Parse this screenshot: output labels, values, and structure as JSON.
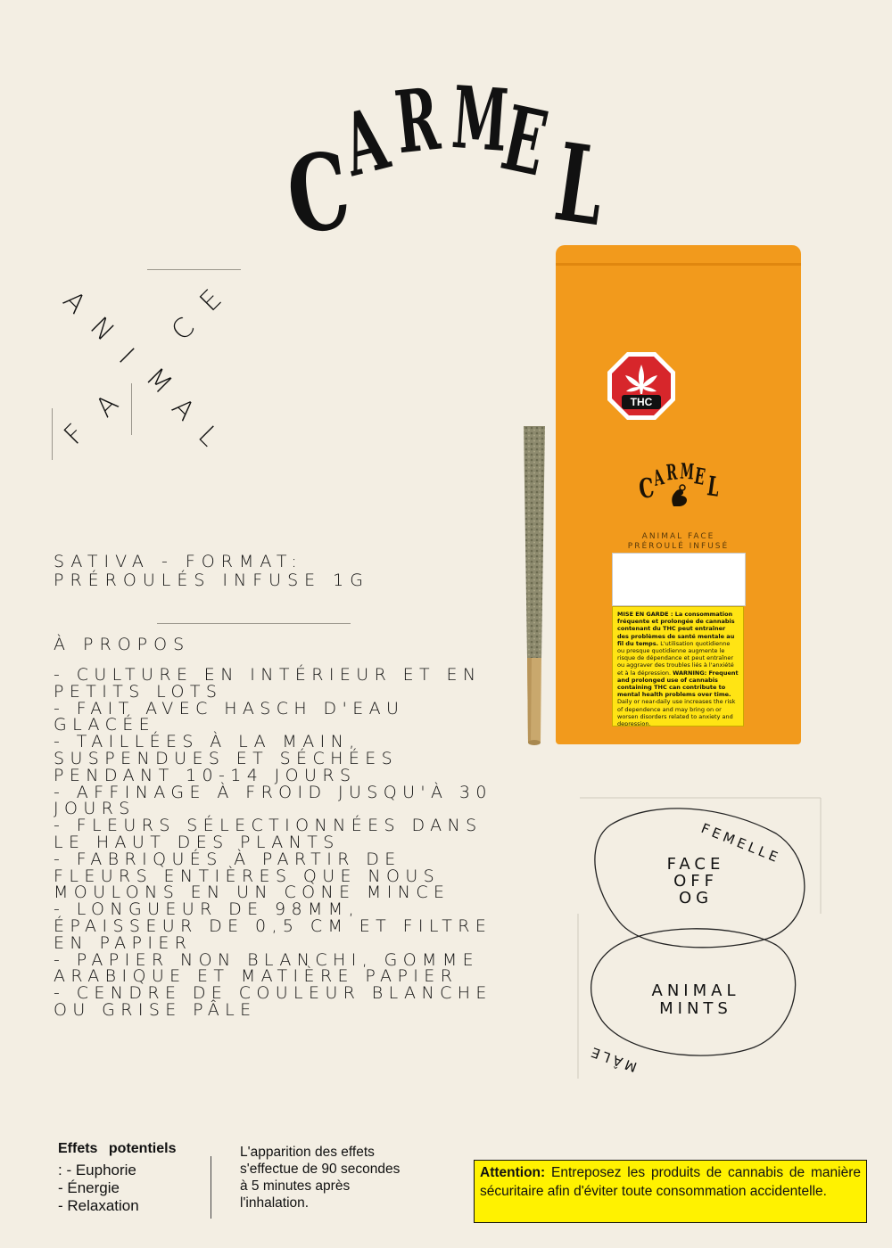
{
  "brand": {
    "logo_letters": [
      "C",
      "A",
      "R",
      "M",
      "E",
      "L"
    ]
  },
  "strain": {
    "word_face_letters": [
      "F",
      "A",
      "C",
      "E"
    ],
    "word_animal_letters": [
      "A",
      "N",
      "I",
      "M",
      "A",
      "L"
    ]
  },
  "product_meta": {
    "line1": "Sativa - Format:",
    "line2": "Préroulés infuse 1g"
  },
  "about": {
    "title": "À propos",
    "items": [
      "- Culture en intérieur et en petits lots",
      "- Fait avec hasch d'eau glacée",
      "- Taillées à la main, suspendues et séchées pendant 10-14 jours",
      "- Affinage à froid jusqu'à 30 jours",
      "- Fleurs sélectionnées dans le haut des plants",
      "- Fabriqués à partir de fleurs entières que nous moulons en un cone mince",
      "- Longueur de 98mm, épaisseur de 0,5 cm et filtre en papier",
      "- Papier non blanchi, gomme arabique et matière papier",
      "- Cendre de couleur blanche ou grise pâle"
    ]
  },
  "package": {
    "thc_label": "THC",
    "logo_letters": [
      "C",
      "A",
      "R",
      "M",
      "E",
      "L"
    ],
    "product_line1": "Animal Face",
    "product_line2": "Préroulé infusé",
    "warning_fr_bold": "MISE EN GARDE : La consommation fréquente et prolongée de cannabis contenant du THC peut entraîner des problèmes de santé mentale au fil du temps.",
    "warning_fr": "L'utilisation quotidienne ou presque quotidienne augmente le risque de dépendance et peut entraîner ou aggraver des troubles liés à l'anxiété et à la dépression.",
    "warning_en_bold": "WARNING: Frequent and prolonged use of cannabis containing THC can contribute to mental health problems over time.",
    "warning_en": "Daily or near-daily use increases the risk of dependence and may bring on or worsen disorders related to anxiety and depression."
  },
  "genetics": {
    "female_label": "FEMELLE",
    "female_strain": [
      "FACE",
      "OFF",
      "OG"
    ],
    "male_label": "MÂLE",
    "male_strain": [
      "ANIMAL",
      "MINTS"
    ]
  },
  "effects": {
    "title": "Effets potentiels",
    "items": [
      ": - Euphorie",
      "- Énergie",
      "- Relaxation"
    ],
    "onset": "L'apparition des effets s'effectue de 90 secondes à 5 minutes après l'inhalation."
  },
  "attention": {
    "label": "Attention:",
    "text": "Entreposez les produits de cannabis de manière sécuritaire afin d'éviter toute consommation accidentelle."
  },
  "colors": {
    "background": "#f3eee3",
    "bag_orange": "#f29a1c",
    "warning_yellow": "#fff200",
    "thc_red": "#d7262b"
  }
}
